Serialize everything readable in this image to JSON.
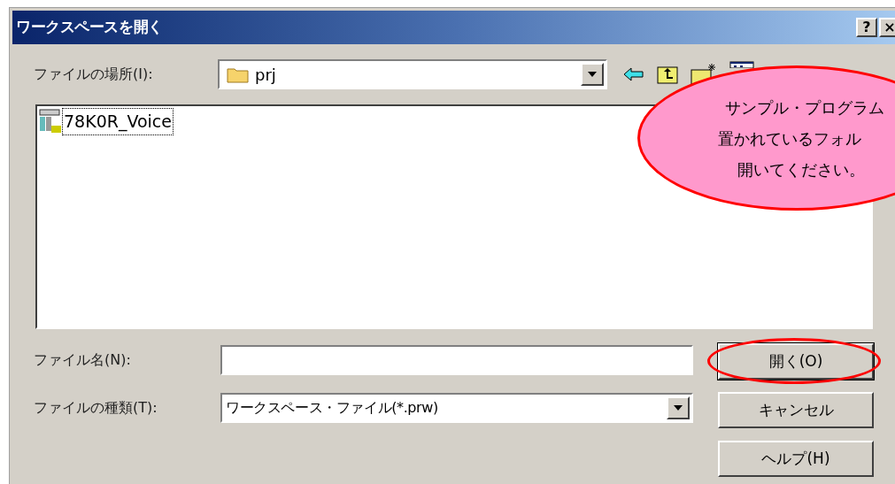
{
  "window": {
    "title": "ワークスペースを開く",
    "title_buttons": [
      {
        "kind": "help",
        "label": "?"
      },
      {
        "kind": "close",
        "label": "×"
      }
    ]
  },
  "location": {
    "label": "ファイルの場所(I):",
    "value": "prj"
  },
  "files": [
    {
      "name": "78K0R_Voice",
      "selected": true
    }
  ],
  "file_name": {
    "label": "ファイル名(N):"
  },
  "file_type": {
    "label": "ファイルの種類(T):",
    "value": "ワークスペース・ファイル(*.prw)"
  },
  "buttons": [
    {
      "label": "開く(O)",
      "circled": true
    },
    {
      "label": "キャンセル",
      "circled": false
    },
    {
      "label": "ヘルプ(H)",
      "circled": false
    }
  ],
  "callout": {
    "lines": [
      "サンプル・プログラム",
      "置かれているフォル",
      "開いてください。"
    ]
  }
}
